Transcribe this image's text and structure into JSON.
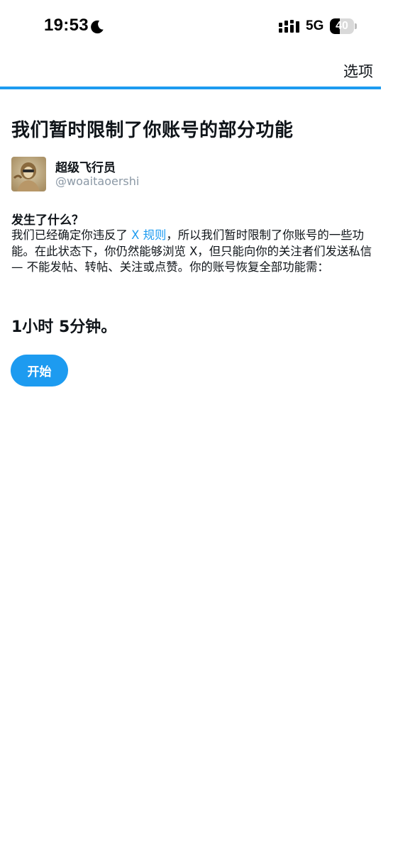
{
  "status_bar": {
    "time": "19:53",
    "network": "5G",
    "battery": "40",
    "battery_level": 0.4,
    "icons": [
      "moon-icon",
      "signal-icon",
      "battery-icon"
    ]
  },
  "header": {
    "options_label": "选项"
  },
  "progress": {
    "value": 1.0,
    "color": "#1d9bf0"
  },
  "notice": {
    "title": "我们暂时限制了你账号的部分功能",
    "account": {
      "display_name": "超级飞行员",
      "handle": "@woaitaoershi"
    },
    "section_heading": "发生了什么？",
    "body_before_link": "我们已经确定你违反了 ",
    "rules_link": "X 规则",
    "body_after_link": "，所以我们暂时限制了你账号的一些功能。在此状态下，你仍然能够浏览 X，但只能向你的关注者们发送私信 — 不能发帖、转帖、关注或点赞。你的账号恢复全部功能需：",
    "countdown": "1小时 5分钟。",
    "start_button": "开始"
  },
  "colors": {
    "accent": "#1d9bf0",
    "text_primary": "#0f1419",
    "text_secondary": "#8b98a5"
  }
}
